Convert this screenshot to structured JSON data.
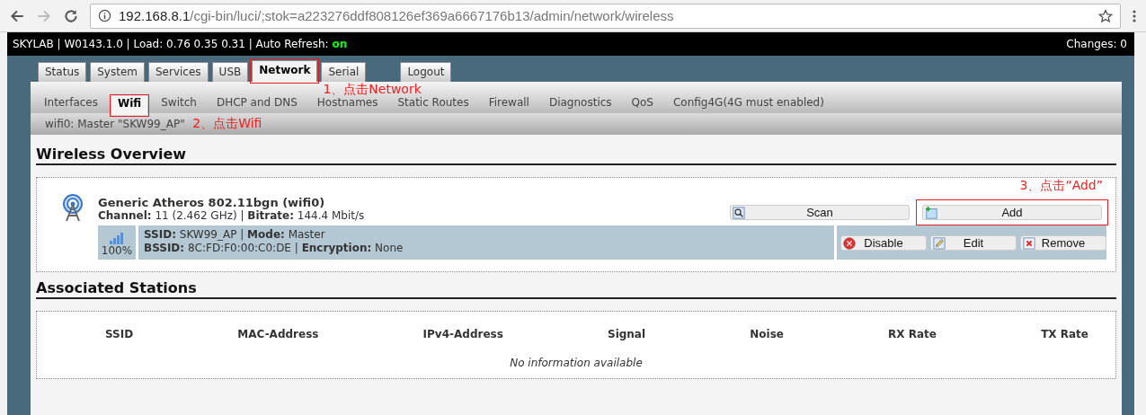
{
  "browser": {
    "url_host": "192.168.8.1",
    "url_path": "/cgi-bin/luci/;stok=a223276ddf808126ef369a6667176b13/admin/network/wireless"
  },
  "status_bar": {
    "info": "SKYLAB | W0143.1.0 | Load: 0.76 0.35 0.31 | Auto Refresh:",
    "auto_refresh": "on",
    "changes": "Changes: 0"
  },
  "tabs": [
    {
      "label": "Status",
      "selected": false
    },
    {
      "label": "System",
      "selected": false
    },
    {
      "label": "Services",
      "selected": false
    },
    {
      "label": "USB",
      "selected": false
    },
    {
      "label": "Network",
      "selected": true,
      "annotation": "1、点击Network"
    },
    {
      "label": "Serial",
      "selected": false
    },
    {
      "label": "Logout",
      "selected": false
    }
  ],
  "subtabs": [
    {
      "label": "Interfaces",
      "selected": false
    },
    {
      "label": "Wifi",
      "selected": true,
      "annotation": "2、点击Wifi"
    },
    {
      "label": "Switch",
      "selected": false
    },
    {
      "label": "DHCP and DNS",
      "selected": false
    },
    {
      "label": "Hostnames",
      "selected": false
    },
    {
      "label": "Static Routes",
      "selected": false
    },
    {
      "label": "Firewall",
      "selected": false
    },
    {
      "label": "Diagnostics",
      "selected": false
    },
    {
      "label": "QoS",
      "selected": false
    },
    {
      "label": "Config4G(4G must enabled)",
      "selected": false
    }
  ],
  "breadcrumb": "wifi0: Master \"SKW99_AP\"",
  "overview": {
    "title": "Wireless Overview",
    "device": {
      "name": "Generic Atheros 802.11bgn (wifi0)",
      "details": "**Channel:** 11 (2.462 GHz) | **Bitrate:** 144.4 Mbit/s"
    },
    "device_buttons": [
      {
        "label": "Scan",
        "kind": "scan"
      },
      {
        "label": "Add",
        "kind": "add",
        "annotation": "3、点击“Add”"
      }
    ],
    "network": {
      "signal": "100%",
      "line_1": "**SSID:** SKW99_AP | **Mode:** Master",
      "line_2": "**BSSID:** 8C:FD:F0:00:C0:DE | **Encryption:** None"
    },
    "network_buttons": [
      {
        "label": "Disable",
        "kind": "disable"
      },
      {
        "label": "Edit",
        "kind": "edit"
      },
      {
        "label": "Remove",
        "kind": "remove"
      }
    ]
  },
  "stations": {
    "title": "Associated Stations",
    "columns": [
      "SSID",
      "MAC-Address",
      "IPv4-Address",
      "Signal",
      "Noise",
      "RX Rate",
      "TX Rate"
    ],
    "empty": "No information available"
  }
}
